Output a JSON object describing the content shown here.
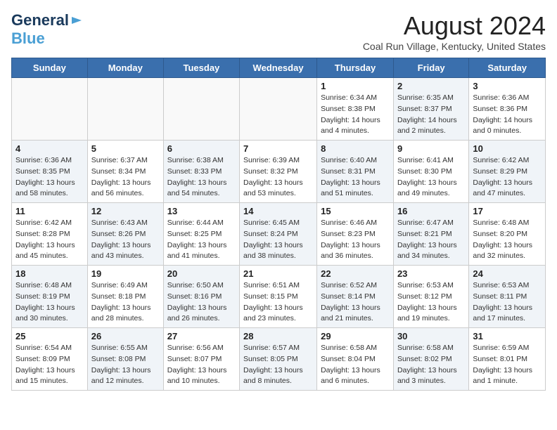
{
  "logo": {
    "line1": "General",
    "line2": "Blue",
    "icon": "▶"
  },
  "title": "August 2024",
  "location": "Coal Run Village, Kentucky, United States",
  "headers": [
    "Sunday",
    "Monday",
    "Tuesday",
    "Wednesday",
    "Thursday",
    "Friday",
    "Saturday"
  ],
  "weeks": [
    [
      {
        "day": "",
        "info": "",
        "shaded": false
      },
      {
        "day": "",
        "info": "",
        "shaded": false
      },
      {
        "day": "",
        "info": "",
        "shaded": false
      },
      {
        "day": "",
        "info": "",
        "shaded": false
      },
      {
        "day": "1",
        "info": "Sunrise: 6:34 AM\nSunset: 8:38 PM\nDaylight: 14 hours\nand 4 minutes.",
        "shaded": false
      },
      {
        "day": "2",
        "info": "Sunrise: 6:35 AM\nSunset: 8:37 PM\nDaylight: 14 hours\nand 2 minutes.",
        "shaded": true
      },
      {
        "day": "3",
        "info": "Sunrise: 6:36 AM\nSunset: 8:36 PM\nDaylight: 14 hours\nand 0 minutes.",
        "shaded": false
      }
    ],
    [
      {
        "day": "4",
        "info": "Sunrise: 6:36 AM\nSunset: 8:35 PM\nDaylight: 13 hours\nand 58 minutes.",
        "shaded": true
      },
      {
        "day": "5",
        "info": "Sunrise: 6:37 AM\nSunset: 8:34 PM\nDaylight: 13 hours\nand 56 minutes.",
        "shaded": false
      },
      {
        "day": "6",
        "info": "Sunrise: 6:38 AM\nSunset: 8:33 PM\nDaylight: 13 hours\nand 54 minutes.",
        "shaded": true
      },
      {
        "day": "7",
        "info": "Sunrise: 6:39 AM\nSunset: 8:32 PM\nDaylight: 13 hours\nand 53 minutes.",
        "shaded": false
      },
      {
        "day": "8",
        "info": "Sunrise: 6:40 AM\nSunset: 8:31 PM\nDaylight: 13 hours\nand 51 minutes.",
        "shaded": true
      },
      {
        "day": "9",
        "info": "Sunrise: 6:41 AM\nSunset: 8:30 PM\nDaylight: 13 hours\nand 49 minutes.",
        "shaded": false
      },
      {
        "day": "10",
        "info": "Sunrise: 6:42 AM\nSunset: 8:29 PM\nDaylight: 13 hours\nand 47 minutes.",
        "shaded": true
      }
    ],
    [
      {
        "day": "11",
        "info": "Sunrise: 6:42 AM\nSunset: 8:28 PM\nDaylight: 13 hours\nand 45 minutes.",
        "shaded": false
      },
      {
        "day": "12",
        "info": "Sunrise: 6:43 AM\nSunset: 8:26 PM\nDaylight: 13 hours\nand 43 minutes.",
        "shaded": true
      },
      {
        "day": "13",
        "info": "Sunrise: 6:44 AM\nSunset: 8:25 PM\nDaylight: 13 hours\nand 41 minutes.",
        "shaded": false
      },
      {
        "day": "14",
        "info": "Sunrise: 6:45 AM\nSunset: 8:24 PM\nDaylight: 13 hours\nand 38 minutes.",
        "shaded": true
      },
      {
        "day": "15",
        "info": "Sunrise: 6:46 AM\nSunset: 8:23 PM\nDaylight: 13 hours\nand 36 minutes.",
        "shaded": false
      },
      {
        "day": "16",
        "info": "Sunrise: 6:47 AM\nSunset: 8:21 PM\nDaylight: 13 hours\nand 34 minutes.",
        "shaded": true
      },
      {
        "day": "17",
        "info": "Sunrise: 6:48 AM\nSunset: 8:20 PM\nDaylight: 13 hours\nand 32 minutes.",
        "shaded": false
      }
    ],
    [
      {
        "day": "18",
        "info": "Sunrise: 6:48 AM\nSunset: 8:19 PM\nDaylight: 13 hours\nand 30 minutes.",
        "shaded": true
      },
      {
        "day": "19",
        "info": "Sunrise: 6:49 AM\nSunset: 8:18 PM\nDaylight: 13 hours\nand 28 minutes.",
        "shaded": false
      },
      {
        "day": "20",
        "info": "Sunrise: 6:50 AM\nSunset: 8:16 PM\nDaylight: 13 hours\nand 26 minutes.",
        "shaded": true
      },
      {
        "day": "21",
        "info": "Sunrise: 6:51 AM\nSunset: 8:15 PM\nDaylight: 13 hours\nand 23 minutes.",
        "shaded": false
      },
      {
        "day": "22",
        "info": "Sunrise: 6:52 AM\nSunset: 8:14 PM\nDaylight: 13 hours\nand 21 minutes.",
        "shaded": true
      },
      {
        "day": "23",
        "info": "Sunrise: 6:53 AM\nSunset: 8:12 PM\nDaylight: 13 hours\nand 19 minutes.",
        "shaded": false
      },
      {
        "day": "24",
        "info": "Sunrise: 6:53 AM\nSunset: 8:11 PM\nDaylight: 13 hours\nand 17 minutes.",
        "shaded": true
      }
    ],
    [
      {
        "day": "25",
        "info": "Sunrise: 6:54 AM\nSunset: 8:09 PM\nDaylight: 13 hours\nand 15 minutes.",
        "shaded": false
      },
      {
        "day": "26",
        "info": "Sunrise: 6:55 AM\nSunset: 8:08 PM\nDaylight: 13 hours\nand 12 minutes.",
        "shaded": true
      },
      {
        "day": "27",
        "info": "Sunrise: 6:56 AM\nSunset: 8:07 PM\nDaylight: 13 hours\nand 10 minutes.",
        "shaded": false
      },
      {
        "day": "28",
        "info": "Sunrise: 6:57 AM\nSunset: 8:05 PM\nDaylight: 13 hours\nand 8 minutes.",
        "shaded": true
      },
      {
        "day": "29",
        "info": "Sunrise: 6:58 AM\nSunset: 8:04 PM\nDaylight: 13 hours\nand 6 minutes.",
        "shaded": false
      },
      {
        "day": "30",
        "info": "Sunrise: 6:58 AM\nSunset: 8:02 PM\nDaylight: 13 hours\nand 3 minutes.",
        "shaded": true
      },
      {
        "day": "31",
        "info": "Sunrise: 6:59 AM\nSunset: 8:01 PM\nDaylight: 13 hours\nand 1 minute.",
        "shaded": false
      }
    ]
  ]
}
